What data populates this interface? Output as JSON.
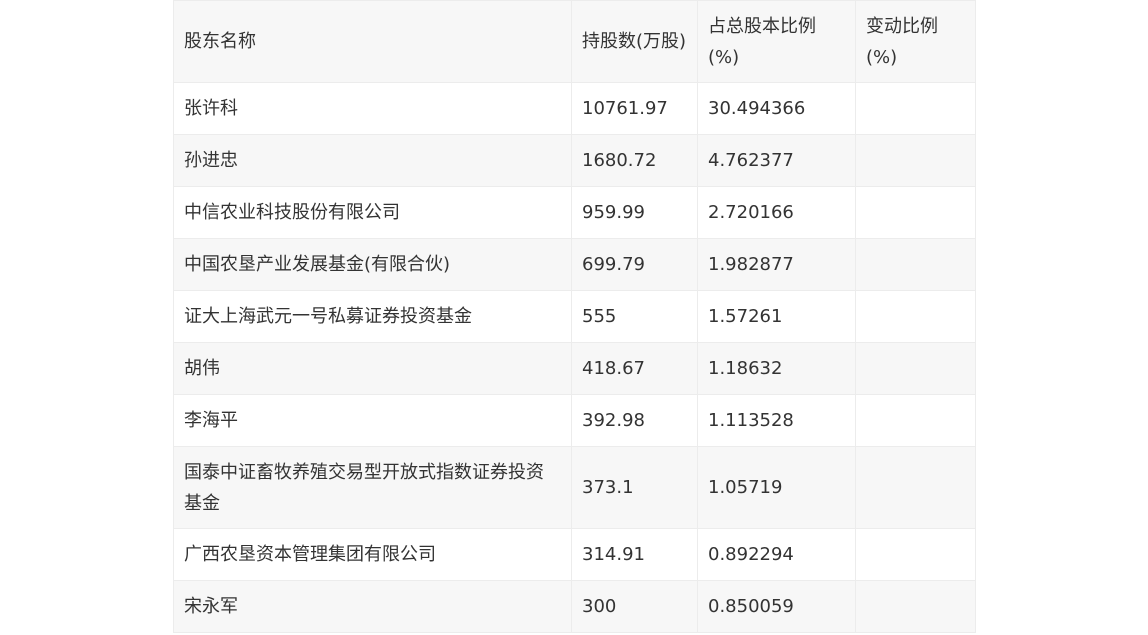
{
  "table": {
    "headers": [
      "股东名称",
      "持股数(万股)",
      "占总股本比例(%)",
      "变动比例(%)"
    ],
    "rows": [
      {
        "name": "张许科",
        "shares": "10761.97",
        "ratio": "30.494366",
        "change": ""
      },
      {
        "name": "孙进忠",
        "shares": "1680.72",
        "ratio": "4.762377",
        "change": ""
      },
      {
        "name": "中信农业科技股份有限公司",
        "shares": "959.99",
        "ratio": "2.720166",
        "change": ""
      },
      {
        "name": "中国农垦产业发展基金(有限合伙)",
        "shares": "699.79",
        "ratio": "1.982877",
        "change": ""
      },
      {
        "name": "证大上海武元一号私募证券投资基金",
        "shares": "555",
        "ratio": "1.57261",
        "change": ""
      },
      {
        "name": "胡伟",
        "shares": "418.67",
        "ratio": "1.18632",
        "change": ""
      },
      {
        "name": "李海平",
        "shares": "392.98",
        "ratio": "1.113528",
        "change": ""
      },
      {
        "name": "国泰中证畜牧养殖交易型开放式指数证券投资基金",
        "shares": "373.1",
        "ratio": "1.05719",
        "change": ""
      },
      {
        "name": "广西农垦资本管理集团有限公司",
        "shares": "314.91",
        "ratio": "0.892294",
        "change": ""
      },
      {
        "name": "宋永军",
        "shares": "300",
        "ratio": "0.850059",
        "change": ""
      }
    ]
  }
}
